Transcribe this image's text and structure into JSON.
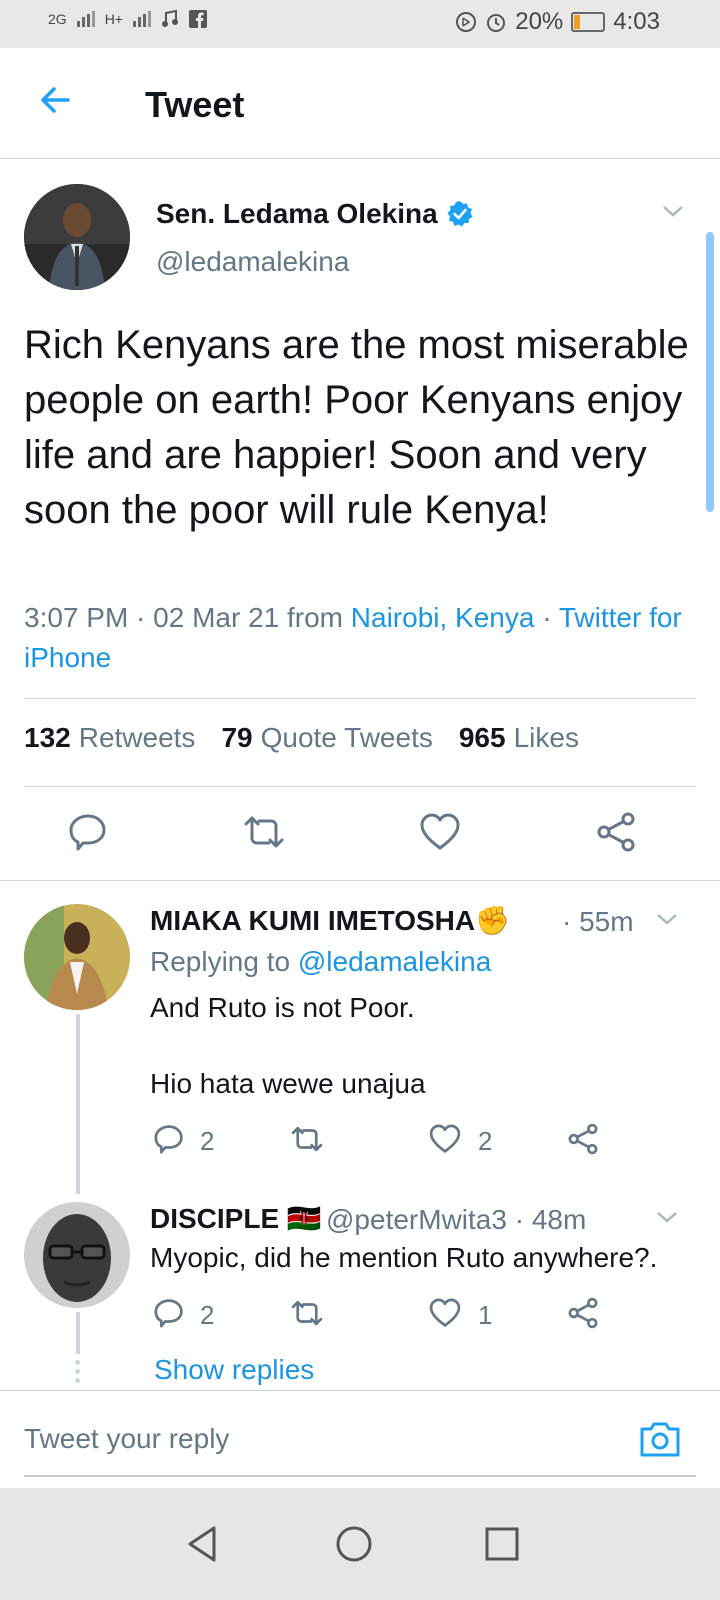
{
  "status_bar": {
    "network_1": "2G",
    "network_2": "H+",
    "battery_percent": "20%",
    "time": "4:03"
  },
  "header": {
    "title": "Tweet"
  },
  "tweet": {
    "author_name": "Sen. Ledama Olekina",
    "author_handle": "@ledamalekina",
    "text": "Rich Kenyans are the most miserable people on earth! Poor Kenyans enjoy life and are happier! Soon and very soon the poor will rule Kenya!",
    "timestamp": "3:07 PM · 02 Mar 21 from ",
    "location": "Nairobi, Kenya",
    "separator": " · ",
    "source": "Twitter for iPhone",
    "stats": {
      "retweets_count": "132",
      "retweets_label": "Retweets",
      "quote_count": "79",
      "quote_label": "Quote Tweets",
      "likes_count": "965",
      "likes_label": "Likes"
    }
  },
  "replies": [
    {
      "author_name": "MIAKA KUMI IMETOSHA✊",
      "time": "· 55m",
      "replying_label": "Replying to ",
      "replying_handle": "@ledamalekina",
      "line1": "And Ruto is not Poor.",
      "line2": "Hio hata wewe unajua",
      "reply_count": "2",
      "like_count": "2"
    },
    {
      "author_name": "DISCIPLE 🇰🇪",
      "handle_time": "@peterMwita3 · 48m",
      "text": "Myopic, did he mention Ruto anywhere?.",
      "reply_count": "2",
      "like_count": "1"
    }
  ],
  "show_replies": "Show replies",
  "reply_input": {
    "placeholder": "Tweet your reply"
  }
}
